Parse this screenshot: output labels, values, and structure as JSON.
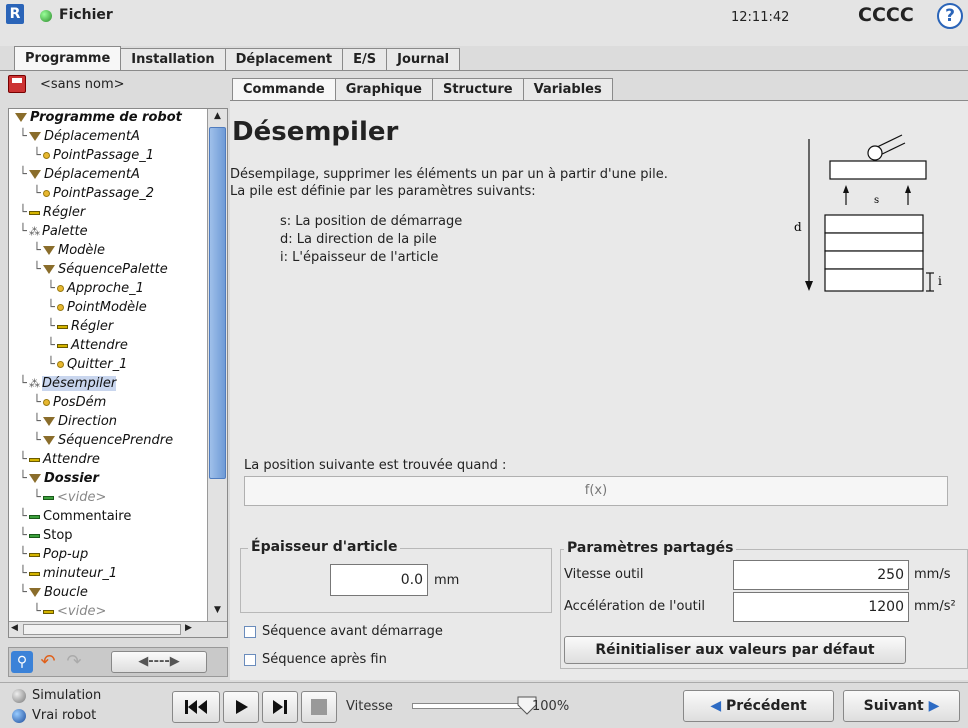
{
  "header": {
    "file_menu": "Fichier",
    "time": "12:11:42",
    "robot_name": "CCCC",
    "help": "?"
  },
  "main_tabs": [
    "Programme",
    "Installation",
    "Déplacement",
    "E/S",
    "Journal"
  ],
  "program_name": "<sans nom>",
  "tree": {
    "items": [
      {
        "label": "Programme de robot",
        "icon": "triangle-icon",
        "style": "bold"
      },
      {
        "label": "DéplacementA",
        "icon": "triangle-icon"
      },
      {
        "label": "PointPassage_1",
        "icon": "dot-icon"
      },
      {
        "label": "DéplacementA",
        "icon": "triangle-icon"
      },
      {
        "label": "PointPassage_2",
        "icon": "dot-icon"
      },
      {
        "label": "Régler",
        "icon": "bar-icon"
      },
      {
        "label": "Palette",
        "icon": "pallet-icon"
      },
      {
        "label": "Modèle",
        "icon": "triangle-icon"
      },
      {
        "label": "SéquencePalette",
        "icon": "triangle-icon"
      },
      {
        "label": "Approche_1",
        "icon": "dot-icon"
      },
      {
        "label": "PointModèle",
        "icon": "dot-icon"
      },
      {
        "label": "Régler",
        "icon": "bar-icon"
      },
      {
        "label": "Attendre",
        "icon": "bar-icon"
      },
      {
        "label": "Quitter_1",
        "icon": "dot-icon"
      },
      {
        "label": "Désempiler",
        "icon": "pallet-icon",
        "style": "selected"
      },
      {
        "label": "PosDém",
        "icon": "dot-icon"
      },
      {
        "label": "Direction",
        "icon": "triangle-icon"
      },
      {
        "label": "SéquencePrendre",
        "icon": "triangle-icon"
      },
      {
        "label": "Attendre",
        "icon": "bar-icon"
      },
      {
        "label": "Dossier",
        "icon": "triangle-icon",
        "style": "bold"
      },
      {
        "label": "<vide>",
        "icon": "green-bar-icon",
        "style": "gray"
      },
      {
        "label": "Commentaire",
        "icon": "green-bar-icon",
        "style": "normal"
      },
      {
        "label": "Stop",
        "icon": "green-bar-icon",
        "style": "normal"
      },
      {
        "label": "Pop-up",
        "icon": "bar-icon"
      },
      {
        "label": "minuteur_1",
        "icon": "bar-icon"
      },
      {
        "label": "Boucle",
        "icon": "triangle-icon"
      },
      {
        "label": "<vide>",
        "icon": "bar-icon",
        "style": "gray"
      }
    ],
    "scroll_arrows": [
      "▲",
      "▼",
      "◀",
      "▶"
    ]
  },
  "sub_tabs": [
    "Commande",
    "Graphique",
    "Structure",
    "Variables"
  ],
  "command": {
    "title": "Désempiler",
    "desc1": "Désempilage, supprimer les éléments un par un à partir d'une pile.",
    "desc2": "La pile est définie par les paramètres suivants:",
    "param_s": "s: La position de démarrage",
    "param_d": "d: La direction de la pile",
    "param_i": "i: L'épaisseur de l'article",
    "diagram_labels": {
      "d": "d",
      "s": "s",
      "i": "i"
    },
    "condition_label": "La position suivante est trouvée quand :",
    "condition_value": "f(x)"
  },
  "thickness": {
    "legend": "Épaisseur d'article",
    "value": "0.0",
    "unit": "mm"
  },
  "shared": {
    "legend": "Paramètres partagés",
    "tool_speed_label": "Vitesse outil",
    "tool_speed_value": "250",
    "tool_speed_unit": "mm/s",
    "tool_accel_label": "Accélération de l'outil",
    "tool_accel_value": "1200",
    "tool_accel_unit": "mm/s²",
    "reset_label": "Réinitialiser aux valeurs par défaut"
  },
  "checkboxes": {
    "before_start": "Séquence avant démarrage",
    "after_end": "Séquence après fin"
  },
  "footer": {
    "mode_simulation": "Simulation",
    "mode_real": "Vrai robot",
    "speed_label": "Vitesse",
    "speed_value": "100%",
    "speed_fraction": 1.0,
    "prev_label": "Précédent",
    "next_label": "Suivant",
    "nav_arrows": "◀----▶"
  },
  "colors": {
    "accent": "#2d6bc4",
    "selected": "#c9d6ee"
  }
}
